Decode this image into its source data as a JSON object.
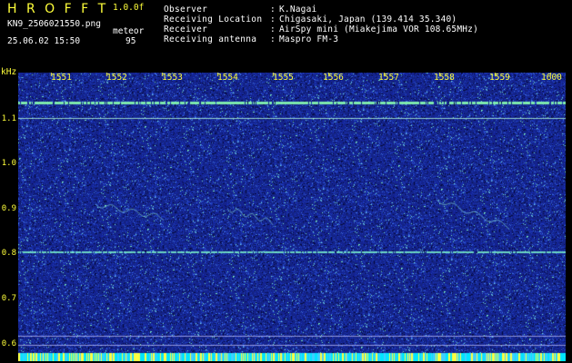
{
  "app": {
    "title": "H R O F F T",
    "version": "1.0.0f",
    "filename": "KN9_2506021550.png",
    "mode_label": "meteor",
    "count": "95",
    "datetime": "25.06.02 15:50"
  },
  "info": [
    {
      "key": "Observer",
      "value": "K.Nagai"
    },
    {
      "key": "Receiving Location",
      "value": "Chigasaki, Japan (139.414 35.340)"
    },
    {
      "key": "Receiver",
      "value": "AirSpy mini (Miakejima VOR 108.65MHz)"
    },
    {
      "key": "Receiving antenna",
      "value": "Maspro FM-3"
    }
  ],
  "colon": ":",
  "axis": {
    "y_unit": "kHz",
    "y_ticks": [
      "1.1",
      "1.0",
      "0.9",
      "0.8",
      "0.7",
      "0.6"
    ],
    "x_ticks": [
      "1551",
      "1552",
      "1553",
      "1554",
      "1555",
      "1556",
      "1557",
      "1558",
      "1559",
      "1600"
    ]
  },
  "colors": {
    "background": "#000000",
    "spectrogram_base": "#1a2a8a",
    "text_yellow": "#ffff3a",
    "text_white": "#ffffff",
    "carrier_line": "#7fffd0",
    "bottom_band": "#00e5ff"
  }
}
